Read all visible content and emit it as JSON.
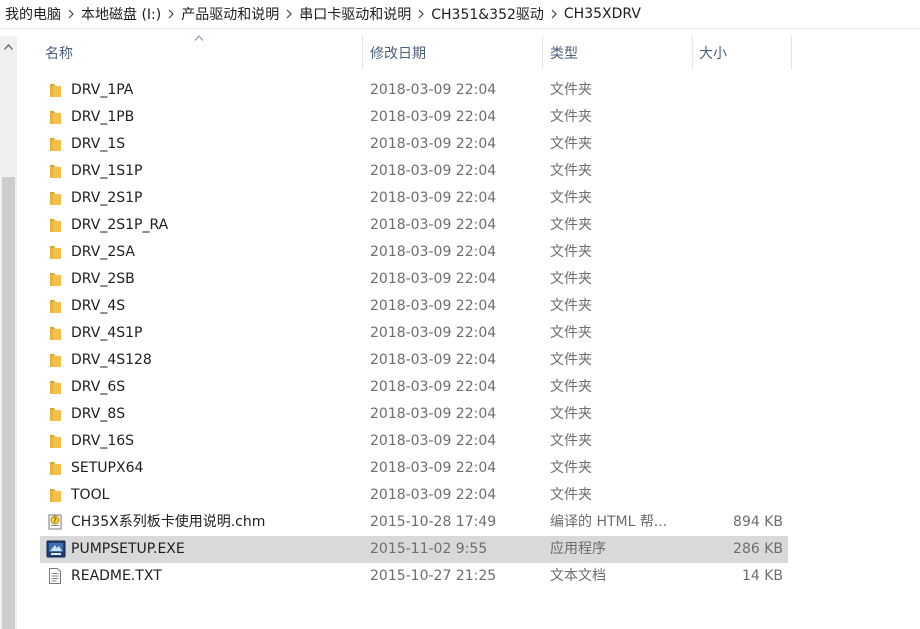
{
  "breadcrumb": [
    "我的电脑",
    "本地磁盘 (I:)",
    "产品驱动和说明",
    "串口卡驱动和说明",
    "CH351&352驱动",
    "CH35XDRV"
  ],
  "columns": {
    "name": "名称",
    "date": "修改日期",
    "type": "类型",
    "size": "大小"
  },
  "files": [
    {
      "icon": "folder-icon",
      "name": "DRV_1PA",
      "date": "2018-03-09 22:04",
      "type": "文件夹",
      "size": ""
    },
    {
      "icon": "folder-icon",
      "name": "DRV_1PB",
      "date": "2018-03-09 22:04",
      "type": "文件夹",
      "size": ""
    },
    {
      "icon": "folder-icon",
      "name": "DRV_1S",
      "date": "2018-03-09 22:04",
      "type": "文件夹",
      "size": ""
    },
    {
      "icon": "folder-icon",
      "name": "DRV_1S1P",
      "date": "2018-03-09 22:04",
      "type": "文件夹",
      "size": ""
    },
    {
      "icon": "folder-icon",
      "name": "DRV_2S1P",
      "date": "2018-03-09 22:04",
      "type": "文件夹",
      "size": ""
    },
    {
      "icon": "folder-icon",
      "name": "DRV_2S1P_RA",
      "date": "2018-03-09 22:04",
      "type": "文件夹",
      "size": ""
    },
    {
      "icon": "folder-icon",
      "name": "DRV_2SA",
      "date": "2018-03-09 22:04",
      "type": "文件夹",
      "size": ""
    },
    {
      "icon": "folder-icon",
      "name": "DRV_2SB",
      "date": "2018-03-09 22:04",
      "type": "文件夹",
      "size": ""
    },
    {
      "icon": "folder-icon",
      "name": "DRV_4S",
      "date": "2018-03-09 22:04",
      "type": "文件夹",
      "size": ""
    },
    {
      "icon": "folder-icon",
      "name": "DRV_4S1P",
      "date": "2018-03-09 22:04",
      "type": "文件夹",
      "size": ""
    },
    {
      "icon": "folder-icon",
      "name": "DRV_4S128",
      "date": "2018-03-09 22:04",
      "type": "文件夹",
      "size": ""
    },
    {
      "icon": "folder-icon",
      "name": "DRV_6S",
      "date": "2018-03-09 22:04",
      "type": "文件夹",
      "size": ""
    },
    {
      "icon": "folder-icon",
      "name": "DRV_8S",
      "date": "2018-03-09 22:04",
      "type": "文件夹",
      "size": ""
    },
    {
      "icon": "folder-icon",
      "name": "DRV_16S",
      "date": "2018-03-09 22:04",
      "type": "文件夹",
      "size": ""
    },
    {
      "icon": "folder-icon",
      "name": "SETUPX64",
      "date": "2018-03-09 22:04",
      "type": "文件夹",
      "size": ""
    },
    {
      "icon": "folder-icon",
      "name": "TOOL",
      "date": "2018-03-09 22:04",
      "type": "文件夹",
      "size": ""
    },
    {
      "icon": "chm-help-icon",
      "name": "CH35X系列板卡使用说明.chm",
      "date": "2015-10-28 17:49",
      "type": "编译的 HTML 帮...",
      "size": "894 KB"
    },
    {
      "icon": "installer-exe-icon",
      "name": "PUMPSETUP.EXE",
      "date": "2015-11-02 9:55",
      "type": "应用程序",
      "size": "286 KB",
      "selected": true
    },
    {
      "icon": "text-document-icon",
      "name": "README.TXT",
      "date": "2015-10-27 21:25",
      "type": "文本文档",
      "size": "14 KB"
    }
  ],
  "colors": {
    "folder": "#f4c04a",
    "selected_row": "#d9d9d9",
    "header_text": "#4c607a",
    "secondary_text": "#6d6d6d"
  }
}
